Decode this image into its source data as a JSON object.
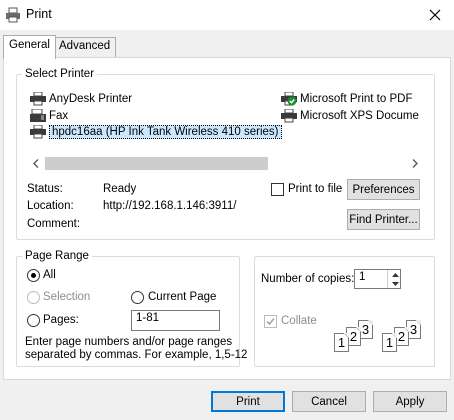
{
  "window": {
    "title": "Print",
    "icon": "printer-icon"
  },
  "tabs": [
    {
      "label": "General",
      "active": true
    },
    {
      "label": "Advanced",
      "active": false
    }
  ],
  "select_printer": {
    "label": "Select Printer",
    "printers": [
      {
        "name": "AnyDesk Printer",
        "icon": "printer-icon",
        "selected": false
      },
      {
        "name": "Fax",
        "icon": "fax-icon",
        "selected": false
      },
      {
        "name": "hpdc16aa (HP Ink Tank Wireless 410 series)",
        "icon": "printer-icon",
        "selected": true
      },
      {
        "name": "Microsoft Print to PDF",
        "icon": "default-printer-icon",
        "selected": false
      },
      {
        "name": "Microsoft XPS Docume",
        "icon": "printer-icon",
        "selected": false
      }
    ],
    "status_label": "Status:",
    "status_value": "Ready",
    "location_label": "Location:",
    "location_value": "http://192.168.1.146:3911/",
    "comment_label": "Comment:",
    "comment_value": "",
    "print_to_file_label": "Print to file",
    "print_to_file_checked": false,
    "preferences_label": "Preferences",
    "find_printer_label": "Find Printer..."
  },
  "page_range": {
    "label": "Page Range",
    "all_label": "All",
    "all_selected": true,
    "selection_label": "Selection",
    "current_page_label": "Current Page",
    "pages_label": "Pages:",
    "pages_value": "1-81",
    "help_line1": "Enter page numbers and/or page ranges",
    "help_line2": "separated by commas.  For example, 1,5-12"
  },
  "copies": {
    "label": "Number of copies:",
    "value": "1",
    "collate_label": "Collate",
    "collate_checked": true,
    "collate_icon_pages": [
      "1",
      "2",
      "3",
      "1",
      "2",
      "3"
    ]
  },
  "buttons": {
    "print": "Print",
    "cancel": "Cancel",
    "apply": "Apply"
  }
}
